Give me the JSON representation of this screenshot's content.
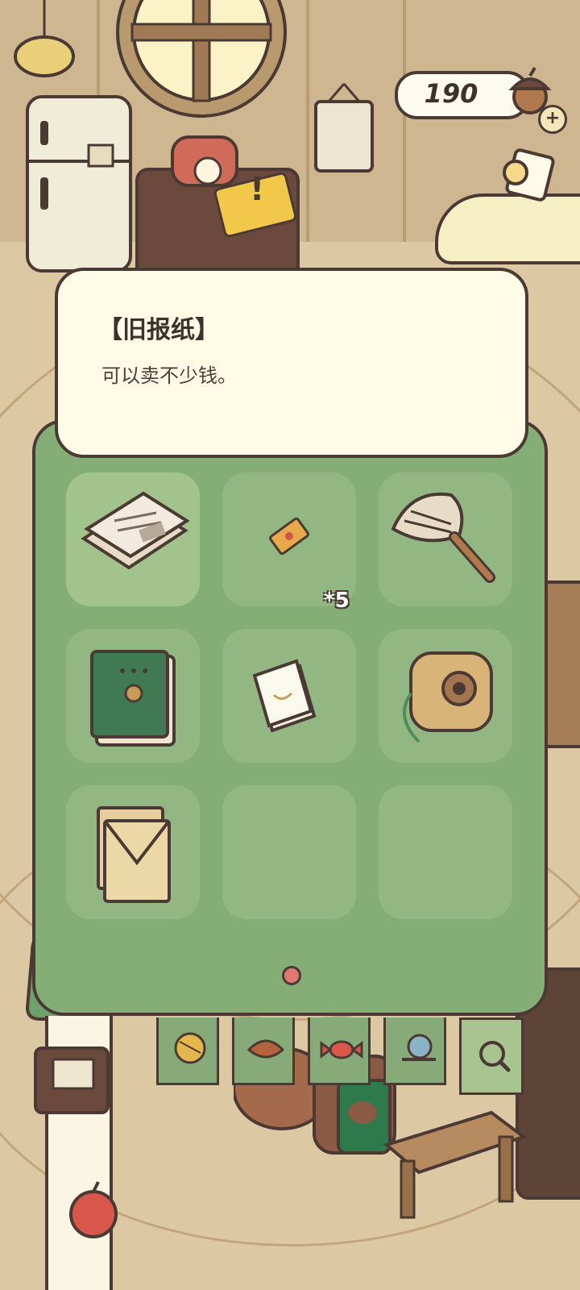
{
  "hud": {
    "coins": "190",
    "acorn_icon": "acorn-coin-icon",
    "add_icon": "plus-icon"
  },
  "info": {
    "title": "【旧报纸】",
    "description": "可以卖不少钱。"
  },
  "inventory": {
    "slots": [
      {
        "item_icon": "old-newspaper-icon",
        "selected": true
      },
      {
        "item_icon": "ticket-icon",
        "count": "*5"
      },
      {
        "item_icon": "feather-duster-icon"
      },
      {
        "item_icon": "green-notebook-icon"
      },
      {
        "item_icon": "small-booklet-icon"
      },
      {
        "item_icon": "instant-camera-icon"
      },
      {
        "item_icon": "envelope-letters-icon"
      },
      {
        "item_icon": null
      },
      {
        "item_icon": null
      }
    ],
    "page_indicator": "page-dot"
  },
  "tabs": [
    {
      "name": "yarn-ball-icon"
    },
    {
      "name": "leaf-icon"
    },
    {
      "name": "candy-icon"
    },
    {
      "name": "snail-shell-icon"
    },
    {
      "name": "magnifier-icon"
    }
  ],
  "colors": {
    "panel_green": "#85ad76",
    "slot_green": "#93b782",
    "slot_selected": "#a3c38c",
    "info_bg": "#fefbe6",
    "outline": "#4a3a33",
    "page_dot": "#e07a6e"
  }
}
